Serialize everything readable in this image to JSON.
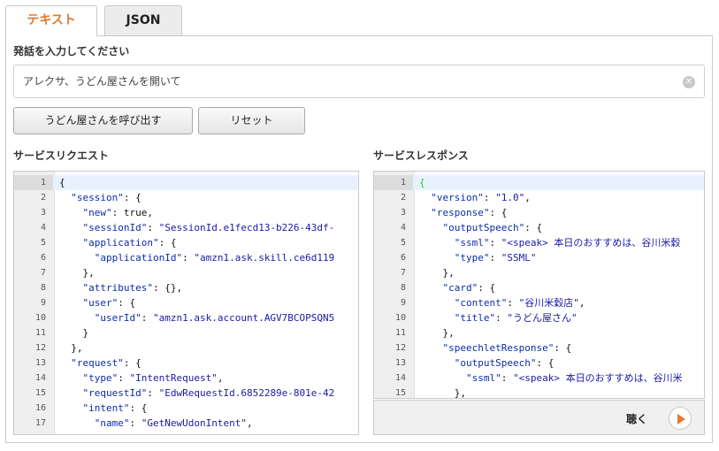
{
  "tabs": {
    "text_label": "テキスト",
    "json_label": "JSON"
  },
  "utterance": {
    "label": "発話を入力してください",
    "value": "アレクサ、うどん屋さんを開いて"
  },
  "buttons": {
    "invoke_label": "うどん屋さんを呼び出す",
    "reset_label": "リセット"
  },
  "request": {
    "label": "サービスリクエスト",
    "lines": [
      [
        {
          "t": "{",
          "c": "p"
        }
      ],
      [
        {
          "t": "  ",
          "c": "p"
        },
        {
          "t": "\"session\"",
          "c": "k"
        },
        {
          "t": ": {",
          "c": "p"
        }
      ],
      [
        {
          "t": "    ",
          "c": "p"
        },
        {
          "t": "\"new\"",
          "c": "k"
        },
        {
          "t": ": true,",
          "c": "p"
        }
      ],
      [
        {
          "t": "    ",
          "c": "p"
        },
        {
          "t": "\"sessionId\"",
          "c": "k"
        },
        {
          "t": ": ",
          "c": "p"
        },
        {
          "t": "\"SessionId.e1fecd13-b226-43df-",
          "c": "s"
        }
      ],
      [
        {
          "t": "    ",
          "c": "p"
        },
        {
          "t": "\"application\"",
          "c": "k"
        },
        {
          "t": ": {",
          "c": "p"
        }
      ],
      [
        {
          "t": "      ",
          "c": "p"
        },
        {
          "t": "\"applicationId\"",
          "c": "k"
        },
        {
          "t": ": ",
          "c": "p"
        },
        {
          "t": "\"amzn1.ask.skill.ce6d119",
          "c": "s"
        }
      ],
      [
        {
          "t": "    },",
          "c": "p"
        }
      ],
      [
        {
          "t": "    ",
          "c": "p"
        },
        {
          "t": "\"attributes\"",
          "c": "k"
        },
        {
          "t": ": {},",
          "c": "p"
        }
      ],
      [
        {
          "t": "    ",
          "c": "p"
        },
        {
          "t": "\"user\"",
          "c": "k"
        },
        {
          "t": ": {",
          "c": "p"
        }
      ],
      [
        {
          "t": "      ",
          "c": "p"
        },
        {
          "t": "\"userId\"",
          "c": "k"
        },
        {
          "t": ": ",
          "c": "p"
        },
        {
          "t": "\"amzn1.ask.account.AGV7BCOPSQN5",
          "c": "s"
        }
      ],
      [
        {
          "t": "    }",
          "c": "p"
        }
      ],
      [
        {
          "t": "  },",
          "c": "p"
        }
      ],
      [
        {
          "t": "  ",
          "c": "p"
        },
        {
          "t": "\"request\"",
          "c": "k"
        },
        {
          "t": ": {",
          "c": "p"
        }
      ],
      [
        {
          "t": "    ",
          "c": "p"
        },
        {
          "t": "\"type\"",
          "c": "k"
        },
        {
          "t": ": ",
          "c": "p"
        },
        {
          "t": "\"IntentRequest\"",
          "c": "s"
        },
        {
          "t": ",",
          "c": "p"
        }
      ],
      [
        {
          "t": "    ",
          "c": "p"
        },
        {
          "t": "\"requestId\"",
          "c": "k"
        },
        {
          "t": ": ",
          "c": "p"
        },
        {
          "t": "\"EdwRequestId.6852289e-801e-42",
          "c": "s"
        }
      ],
      [
        {
          "t": "    ",
          "c": "p"
        },
        {
          "t": "\"intent\"",
          "c": "k"
        },
        {
          "t": ": {",
          "c": "p"
        }
      ],
      [
        {
          "t": "      ",
          "c": "p"
        },
        {
          "t": "\"name\"",
          "c": "k"
        },
        {
          "t": ": ",
          "c": "p"
        },
        {
          "t": "\"GetNewUdonIntent\"",
          "c": "s"
        },
        {
          "t": ",",
          "c": "p"
        }
      ]
    ]
  },
  "response": {
    "label": "サービスレスポンス",
    "lines": [
      [
        {
          "t": "{",
          "c": "g"
        }
      ],
      [
        {
          "t": "  ",
          "c": "p"
        },
        {
          "t": "\"version\"",
          "c": "k"
        },
        {
          "t": ": ",
          "c": "p"
        },
        {
          "t": "\"1.0\"",
          "c": "s"
        },
        {
          "t": ",",
          "c": "p"
        }
      ],
      [
        {
          "t": "  ",
          "c": "p"
        },
        {
          "t": "\"response\"",
          "c": "k"
        },
        {
          "t": ": {",
          "c": "p"
        }
      ],
      [
        {
          "t": "    ",
          "c": "p"
        },
        {
          "t": "\"outputSpeech\"",
          "c": "k"
        },
        {
          "t": ": {",
          "c": "p"
        }
      ],
      [
        {
          "t": "      ",
          "c": "p"
        },
        {
          "t": "\"ssml\"",
          "c": "k"
        },
        {
          "t": ": ",
          "c": "p"
        },
        {
          "t": "\"<speak> 本日のおすすめは、谷川米穀",
          "c": "s"
        }
      ],
      [
        {
          "t": "      ",
          "c": "p"
        },
        {
          "t": "\"type\"",
          "c": "k"
        },
        {
          "t": ": ",
          "c": "p"
        },
        {
          "t": "\"SSML\"",
          "c": "s"
        }
      ],
      [
        {
          "t": "    },",
          "c": "p"
        }
      ],
      [
        {
          "t": "    ",
          "c": "p"
        },
        {
          "t": "\"card\"",
          "c": "k"
        },
        {
          "t": ": {",
          "c": "p"
        }
      ],
      [
        {
          "t": "      ",
          "c": "p"
        },
        {
          "t": "\"content\"",
          "c": "k"
        },
        {
          "t": ": ",
          "c": "p"
        },
        {
          "t": "\"谷川米穀店\"",
          "c": "s"
        },
        {
          "t": ",",
          "c": "p"
        }
      ],
      [
        {
          "t": "      ",
          "c": "p"
        },
        {
          "t": "\"title\"",
          "c": "k"
        },
        {
          "t": ": ",
          "c": "p"
        },
        {
          "t": "\"うどん屋さん\"",
          "c": "s"
        }
      ],
      [
        {
          "t": "    },",
          "c": "p"
        }
      ],
      [
        {
          "t": "    ",
          "c": "p"
        },
        {
          "t": "\"speechletResponse\"",
          "c": "k"
        },
        {
          "t": ": {",
          "c": "p"
        }
      ],
      [
        {
          "t": "      ",
          "c": "p"
        },
        {
          "t": "\"outputSpeech\"",
          "c": "k"
        },
        {
          "t": ": {",
          "c": "p"
        }
      ],
      [
        {
          "t": "        ",
          "c": "p"
        },
        {
          "t": "\"ssml\"",
          "c": "k"
        },
        {
          "t": ": ",
          "c": "p"
        },
        {
          "t": "\"<speak> 本日のおすすめは、谷川米",
          "c": "s"
        }
      ],
      [
        {
          "t": "      },",
          "c": "p"
        }
      ]
    ]
  },
  "listen": {
    "label": "聴く"
  },
  "colors": {
    "accent": "#e0792a",
    "key": "#0b2cad",
    "string": "#1a1aa6",
    "active_line": "#e8f2fe"
  },
  "icons": {
    "clear": "clear-circle-icon",
    "play": "play-icon"
  }
}
